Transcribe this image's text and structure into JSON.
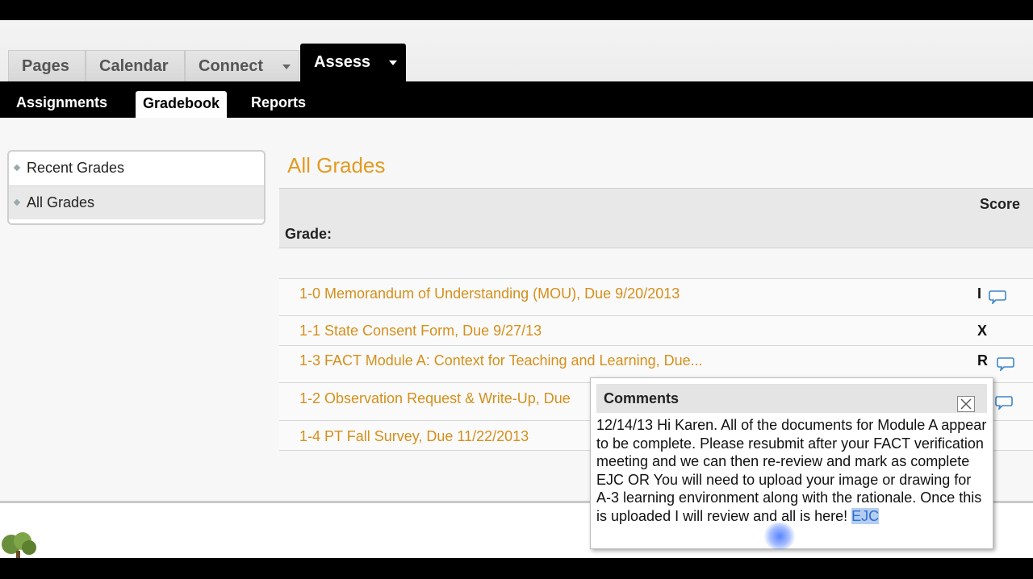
{
  "tabs": [
    {
      "label": "Pages"
    },
    {
      "label": "Calendar"
    },
    {
      "label": "Connect"
    },
    {
      "label": "Assess"
    }
  ],
  "subnav": [
    {
      "label": "Assignments"
    },
    {
      "label": "Gradebook"
    },
    {
      "label": "Reports"
    }
  ],
  "sidebar": {
    "items": [
      {
        "label": "Recent Grades"
      },
      {
        "label": "All Grades"
      }
    ]
  },
  "main": {
    "heading": "All Grades",
    "score_header": "Score",
    "grade_label": "Grade:",
    "rows": [
      {
        "title": "1-0 Memorandum of Understanding (MOU), Due 9/20/2013",
        "score": "I"
      },
      {
        "title": "1-1 State Consent Form, Due 9/27/13",
        "score": "X"
      },
      {
        "title": "1-3 FACT Module A: Context for Teaching and Learning, Due...",
        "score": "R"
      },
      {
        "title": "1-2 Observation Request & Write-Up, Due",
        "score": ""
      },
      {
        "title": "1-4 PT Fall Survey, Due 11/22/2013",
        "score": ""
      }
    ]
  },
  "comments": {
    "title": "Comments",
    "body": "12/14/13 Hi Karen. All of the documents for Module A appear to be complete. Please resubmit after your FACT verification meeting and we can then re-review and mark as complete EJC OR You will need to upload your image or drawing for A-3 learning environment along with the rationale. Once this is uploaded I will review and all is here! ",
    "highlight": "EJC"
  },
  "colors": {
    "accent": "#e39b22",
    "link": "#d58f1b",
    "nav": "#000000",
    "selection": "#b4cdf2"
  },
  "icons": {
    "comment": "speech-bubble-icon",
    "close": "close-icon",
    "dropdown": "caret-down-icon"
  }
}
